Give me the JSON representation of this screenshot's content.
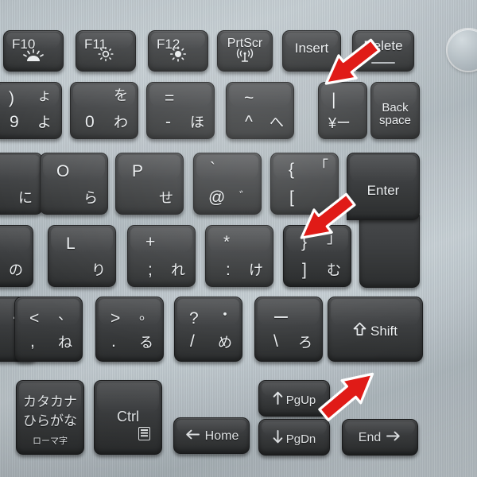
{
  "scene": {
    "subject": "japanese-laptop-keyboard-closeup",
    "deck_color": "#b9c3c8",
    "key_color": "#3d3f41",
    "legend_color": "#eceff1",
    "arrow_color": "#e01b17",
    "arrow_outline": "#ffffff"
  },
  "power_button": {
    "name": "power-button"
  },
  "rows": {
    "function_row": [
      {
        "id": "f10",
        "top": "F10",
        "icon": "keyboard-backlight-icon"
      },
      {
        "id": "f11",
        "top": "F11",
        "icon": "brightness-down-icon"
      },
      {
        "id": "f12",
        "top": "F12",
        "icon": "brightness-up-icon"
      },
      {
        "id": "prtscr",
        "top": "PrtScr",
        "icon": "wireless-antenna-icon"
      },
      {
        "id": "insert",
        "top": "Insert",
        "icon": ""
      },
      {
        "id": "delete",
        "top": "Delete",
        "icon": "underline-mark"
      }
    ],
    "number_row": [
      {
        "id": "9",
        "tl": ")",
        "bl": "9",
        "tr": "ょ",
        "br": "よ"
      },
      {
        "id": "0",
        "tl": "",
        "bl": "0",
        "tr": "を",
        "br": "わ"
      },
      {
        "id": "minus",
        "tl": "=",
        "bl": "-",
        "tr": "",
        "br": "ほ"
      },
      {
        "id": "caret",
        "tl": "~",
        "bl": "^",
        "tr": "",
        "br": "へ"
      },
      {
        "id": "yen",
        "tl": "|",
        "bl": "¥ー",
        "tr": "",
        "br": ""
      },
      {
        "id": "backspace",
        "word_lines": [
          "Back",
          "space"
        ]
      }
    ],
    "top_row": [
      {
        "id": "i",
        "tl": "",
        "bl": "",
        "tr": "",
        "br": "に"
      },
      {
        "id": "o",
        "tl": "O",
        "br": "ら"
      },
      {
        "id": "p",
        "tl": "P",
        "br": "せ"
      },
      {
        "id": "at",
        "tl": "`",
        "br": "@",
        "br2": "゛"
      },
      {
        "id": "bracket_left",
        "tl": "{",
        "bl": "[",
        "tr": "「",
        "br": ""
      },
      {
        "id": "enter",
        "word": "Enter"
      }
    ],
    "home_row": [
      {
        "id": "k",
        "br": "の"
      },
      {
        "id": "l",
        "tl": "L",
        "br": "り"
      },
      {
        "id": "semicolon",
        "tl": "+",
        "bl": ";",
        "br": "れ"
      },
      {
        "id": "colon",
        "tl": "*",
        "bl": ":",
        "br": "け"
      },
      {
        "id": "bracket_right",
        "tl": "}",
        "bl": "]",
        "tr": "」",
        "br": "む"
      }
    ],
    "bottom_row": [
      {
        "id": "comma",
        "tl": "<",
        "bl": ",",
        "tr": "、",
        "br": "ね"
      },
      {
        "id": "period",
        "tl": ">",
        "bl": ".",
        "tr": "。",
        "br": "る"
      },
      {
        "id": "slash",
        "tl": "?",
        "bl": "/",
        "tr": "・",
        "br": "め"
      },
      {
        "id": "backslash_ro",
        "tl": "ー",
        "bl": "\\",
        "br": "ろ"
      },
      {
        "id": "shift",
        "word": "Shift",
        "icon": "shift-arrow-icon"
      }
    ],
    "modifier_row": [
      {
        "id": "kana",
        "lines": [
          "カタカナ",
          "ひらがな"
        ],
        "sub": "ローマ字"
      },
      {
        "id": "ctrl",
        "word": "Ctrl",
        "icon": "context-menu-icon"
      },
      {
        "id": "home",
        "word": "Home",
        "icon": "arrow-left-icon"
      },
      {
        "id": "pgup",
        "word": "PgUp",
        "icon": "arrow-up-icon"
      },
      {
        "id": "pgdn",
        "word": "PgDn",
        "icon": "arrow-down-icon"
      },
      {
        "id": "end",
        "word": "End",
        "icon": "arrow-right-icon"
      }
    ]
  },
  "annotations": [
    {
      "id": "arrow-1",
      "points_to": "yen-backslash-key",
      "direction": "down-right"
    },
    {
      "id": "arrow-2",
      "points_to": "bracket-right-and-enter-gap",
      "direction": "down-right"
    },
    {
      "id": "arrow-3",
      "points_to": "backslash-ro-key",
      "direction": "up-left"
    }
  ]
}
